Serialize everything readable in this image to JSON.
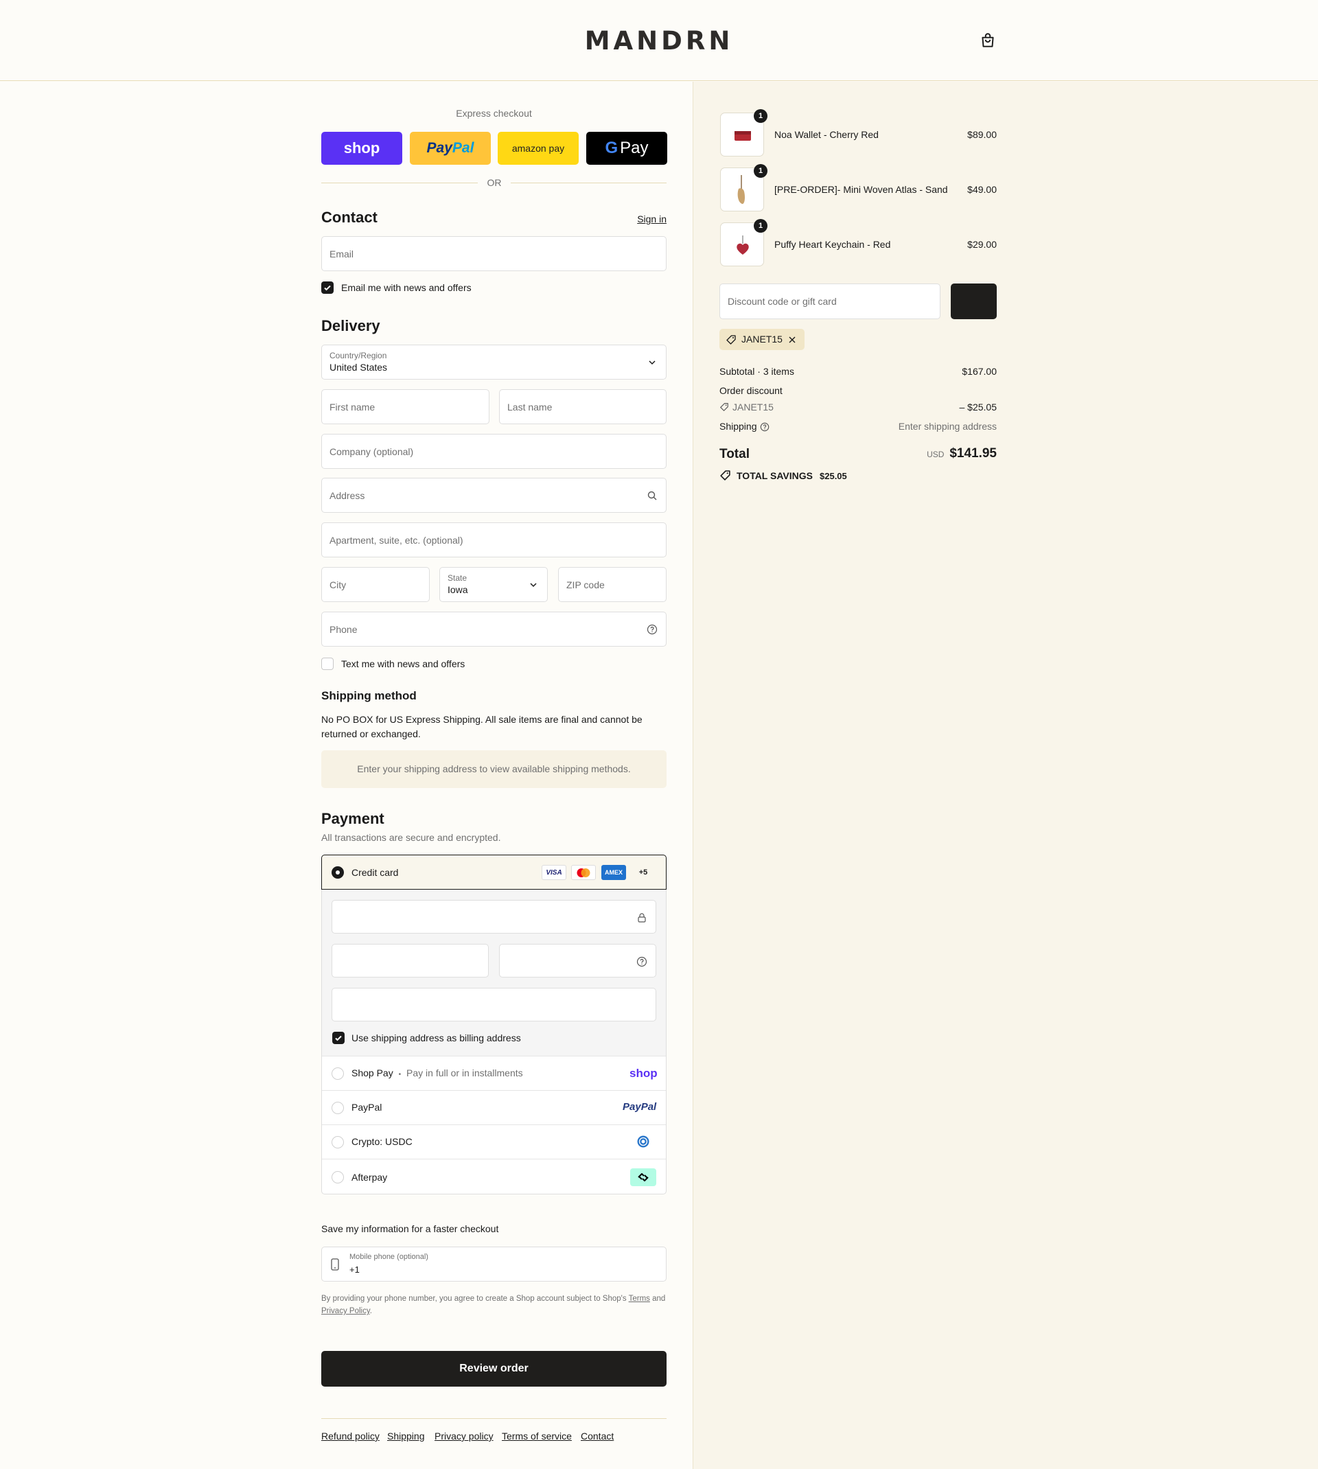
{
  "header": {
    "logo": "MANDRN",
    "cart_icon": "shopping-bag-icon"
  },
  "express": {
    "title": "Express checkout",
    "buttons": [
      "shop",
      "PayPal",
      "amazon pay",
      "G Pay"
    ],
    "or": "OR"
  },
  "contact": {
    "title": "Contact",
    "sign_in": "Sign in",
    "email_placeholder": "Email",
    "news_label": "Email me with news and offers",
    "news_checked": true
  },
  "delivery": {
    "title": "Delivery",
    "country_label": "Country/Region",
    "country_value": "United States",
    "first_name": "First name",
    "last_name": "Last name",
    "company": "Company (optional)",
    "address": "Address",
    "apartment": "Apartment, suite, etc. (optional)",
    "city": "City",
    "state_label": "State",
    "state_value": "Iowa",
    "zip": "ZIP code",
    "phone": "Phone",
    "text_label": "Text me with news and offers",
    "text_checked": false
  },
  "shipping_method": {
    "title": "Shipping method",
    "note": "No PO BOX for US Express Shipping. All sale items are final and cannot be returned or exchanged.",
    "notice": "Enter your shipping address to view available shipping methods."
  },
  "payment": {
    "title": "Payment",
    "subtitle": "All transactions are secure and encrypted.",
    "credit_card": "Credit card",
    "cards": [
      "VISA",
      "mastercard",
      "AMEX",
      "+5"
    ],
    "billing_label": "Use shipping address as billing address",
    "billing_checked": true,
    "shop_pay": "Shop Pay",
    "shop_pay_dot": "•",
    "shop_pay_sub": "Pay in full or in installments",
    "shop_pay_logo": "shop",
    "paypal": "PayPal",
    "paypal_logo": "PayPal",
    "crypto": "Crypto: USDC",
    "afterpay": "Afterpay"
  },
  "save": {
    "title": "Save my information for a faster checkout",
    "phone_label": "Mobile phone (optional)",
    "phone_value": "+1",
    "legal_1": "By providing your phone number, you agree to create a Shop account subject to Shop's",
    "terms": "Terms",
    "and": "and",
    "privacy": "Privacy Policy",
    "period": "."
  },
  "review_button": "Review order",
  "footer_links": [
    "Refund policy",
    "Shipping",
    "Privacy policy",
    "Terms of service",
    "Contact"
  ],
  "order": {
    "items": [
      {
        "name": "Noa Wallet - Cherry Red",
        "qty": "1",
        "price": "$89.00"
      },
      {
        "name": "[PRE-ORDER]- Mini Woven Atlas - Sand",
        "qty": "1",
        "price": "$49.00"
      },
      {
        "name": "Puffy Heart Keychain - Red",
        "qty": "1",
        "price": "$29.00"
      }
    ],
    "discount_placeholder": "Discount code or gift card",
    "chip_code": "JANET15",
    "subtotal_label": "Subtotal · 3 items",
    "subtotal_value": "$167.00",
    "order_discount_label": "Order discount",
    "discount_code": "JANET15",
    "discount_value": "– $25.05",
    "shipping_label": "Shipping",
    "shipping_value": "Enter shipping address",
    "total_label": "Total",
    "currency": "USD",
    "total_value": "$141.95",
    "savings_label": "TOTAL SAVINGS",
    "savings_value": "$25.05"
  },
  "colors": {
    "accent": "#1f1e1c",
    "shop": "#5a31f4",
    "paypal": "#ffc439",
    "amazon": "#ffd814",
    "background": "#fdfcf8",
    "summary": "#f9f5ea"
  }
}
